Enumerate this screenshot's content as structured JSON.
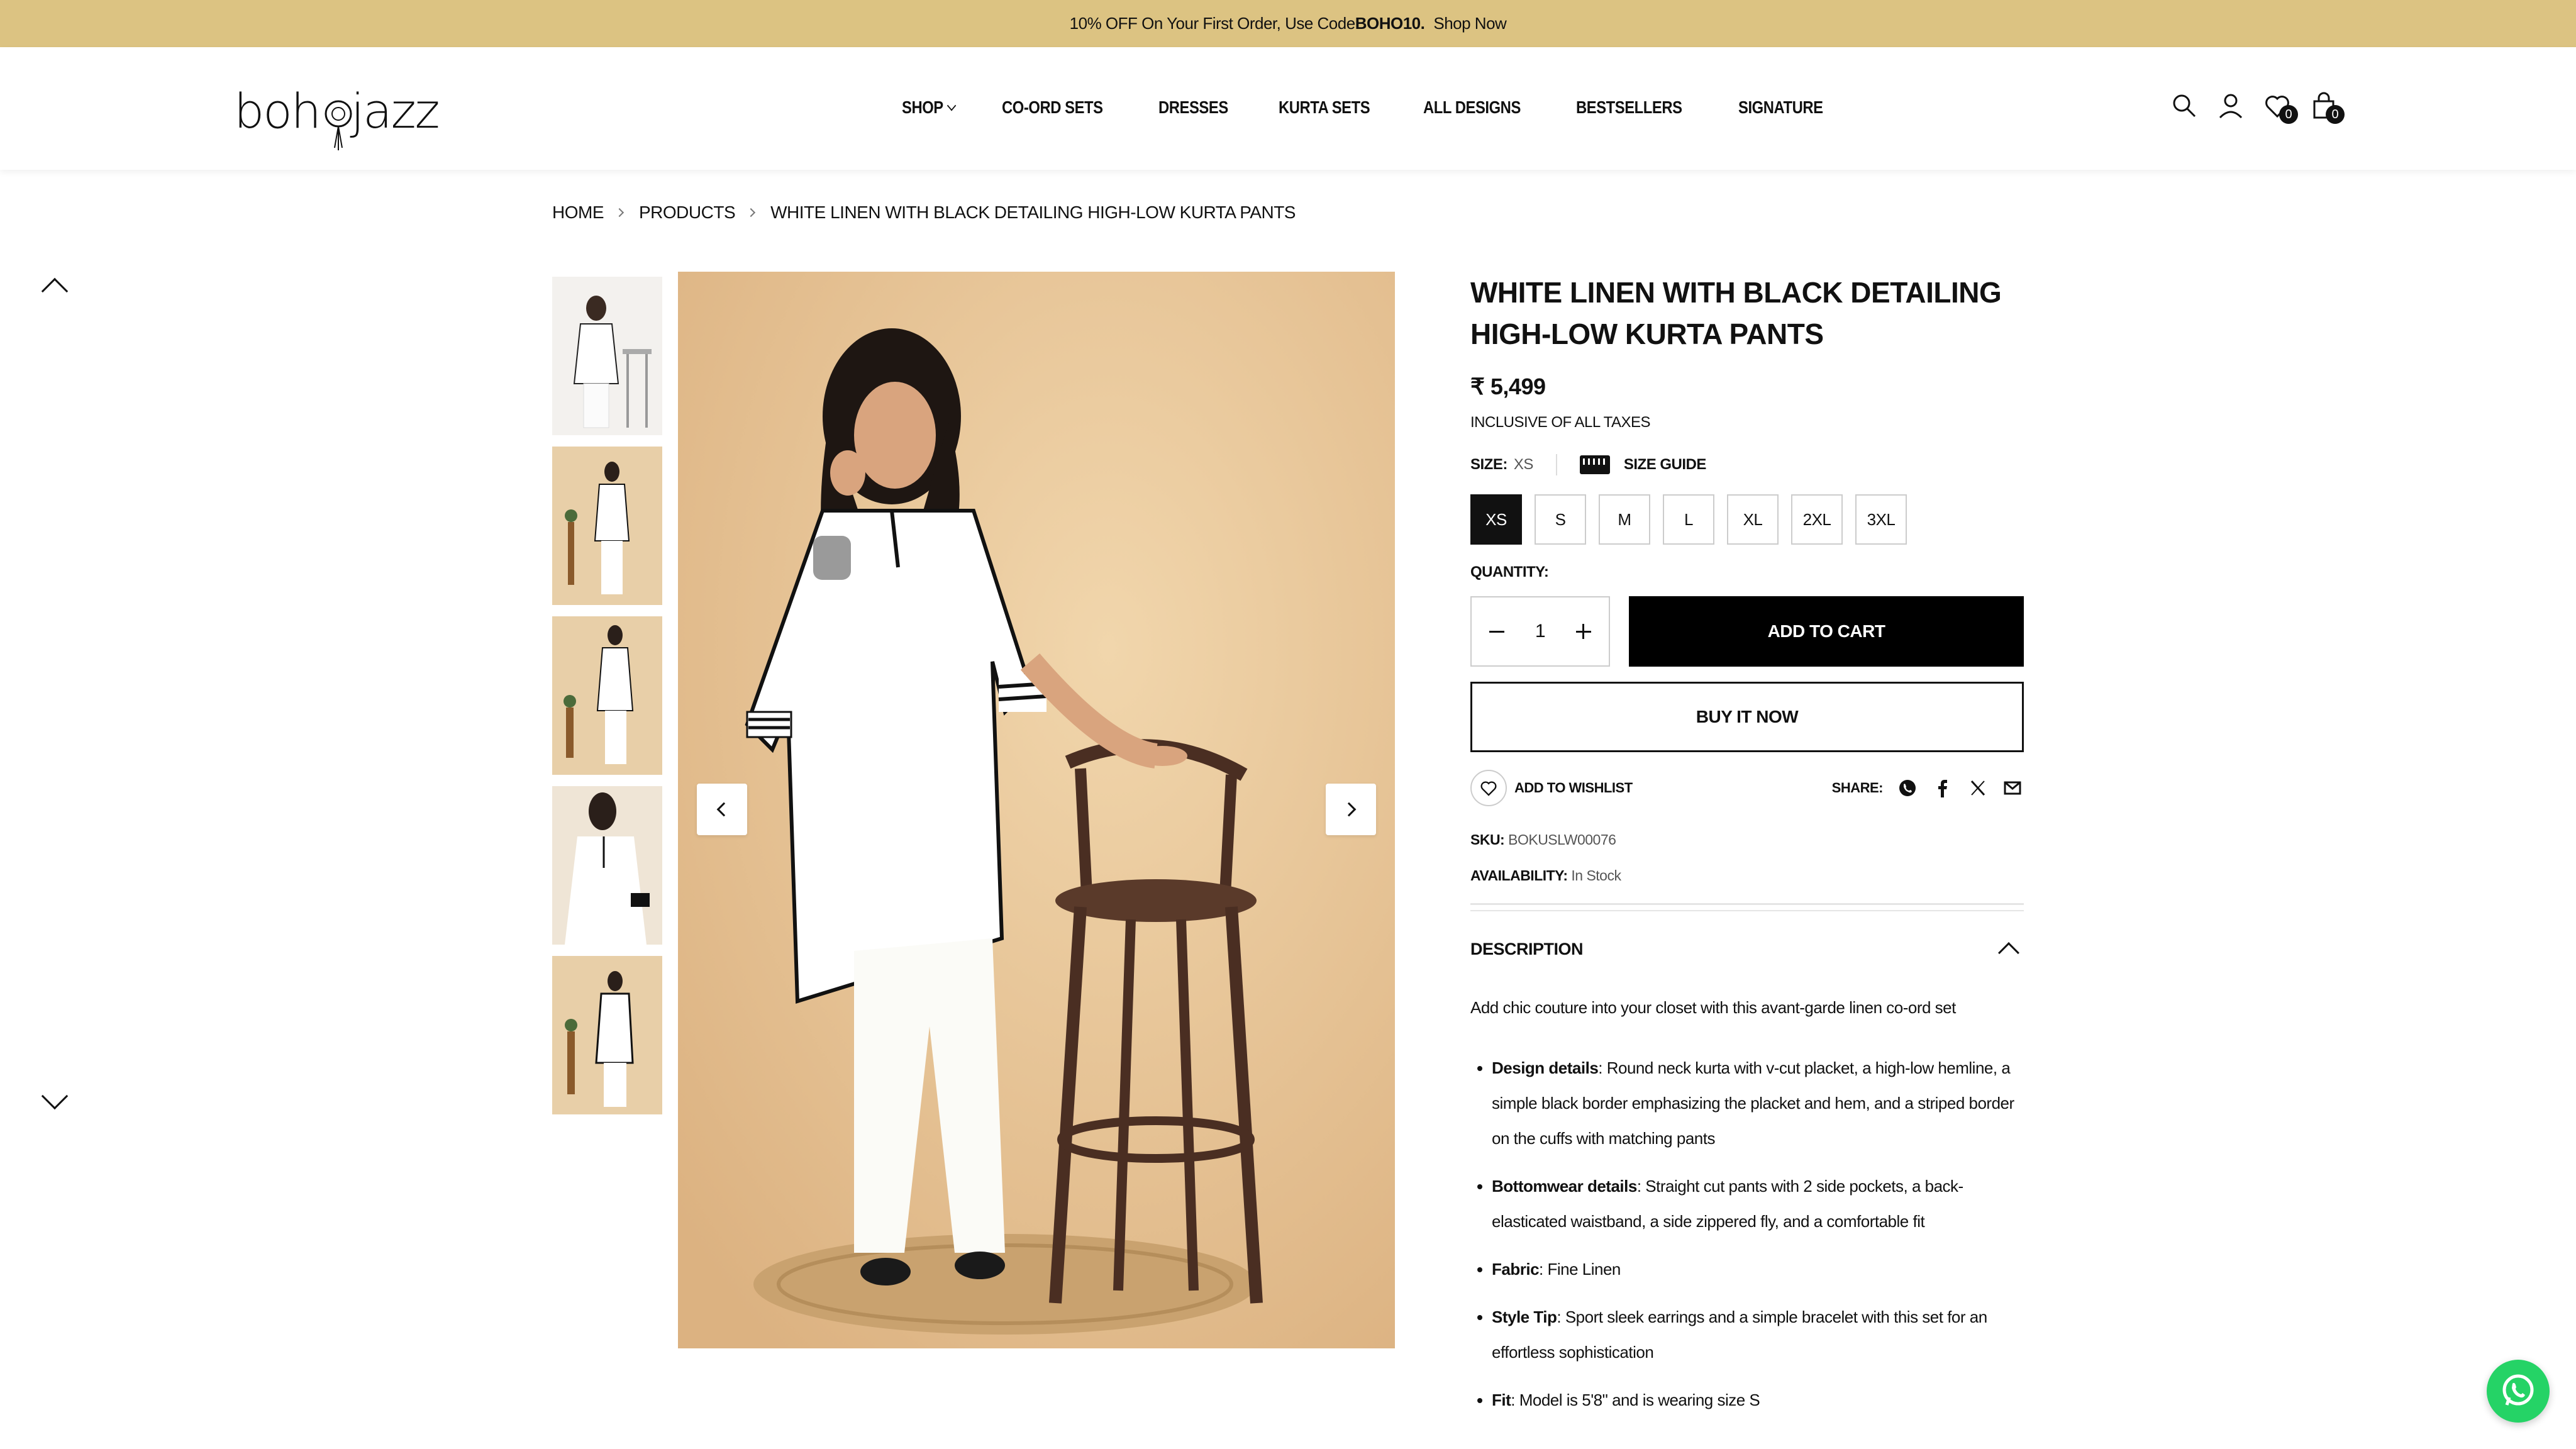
{
  "announcement": {
    "text_before": "10% OFF On Your First Order, Use Code ",
    "code": "BOHO10.",
    "shop_now": "Shop Now"
  },
  "header": {
    "logo_text": "bohojazz",
    "nav": [
      "SHOP",
      "CO-ORD SETS",
      "DRESSES",
      "KURTA SETS",
      "ALL DESIGNS",
      "BESTSELLERS",
      "SIGNATURE"
    ],
    "wishlist_count": "0",
    "cart_count": "0",
    "icons": [
      "search-icon",
      "user-icon",
      "heart-icon",
      "bag-icon"
    ]
  },
  "breadcrumb": [
    "HOME",
    "PRODUCTS",
    "WHITE LINEN WITH BLACK DETAILING HIGH-LOW KURTA PANTS"
  ],
  "product": {
    "title": "WHITE LINEN WITH BLACK DETAILING HIGH-LOW KURTA PANTS",
    "price": "₹ 5,499",
    "tax_note": "INCLUSIVE OF ALL TAXES",
    "size_label": "SIZE:",
    "size_selected": "XS",
    "size_guide": "SIZE GUIDE",
    "sizes": [
      "XS",
      "S",
      "M",
      "L",
      "XL",
      "2XL",
      "3XL"
    ],
    "quantity_label": "QUANTITY:",
    "quantity": "1",
    "add_to_cart": "ADD TO CART",
    "buy_now": "BUY IT NOW",
    "wishlist": "ADD TO WISHLIST",
    "share_label": "SHARE:",
    "sku_label": "SKU:",
    "sku": "BOKUSLW00076",
    "availability_label": "AVAILABILITY:",
    "availability": "In Stock"
  },
  "description": {
    "heading": "DESCRIPTION",
    "intro": "Add chic couture into your closet with this avant-garde linen co-ord set",
    "items": [
      {
        "k": "Design details",
        "v": ": Round neck kurta with v-cut placket, a high-low hemline, a simple black border emphasizing the placket and hem, and a striped border on the cuffs with matching pants"
      },
      {
        "k": "Bottomwear details",
        "v": ": Straight cut pants with 2 side pockets, a back-elasticated waistband, a side zippered fly, and a comfortable fit"
      },
      {
        "k": "Fabric",
        "v": ": Fine Linen"
      },
      {
        "k": "Style Tip",
        "v": ": Sport sleek earrings and a simple bracelet with this set for an effortless sophistication"
      },
      {
        "k": "Fit",
        "v": ": Model is 5'8\" and is wearing size S"
      }
    ]
  },
  "colors": {
    "announcement_bg": "#dcc382",
    "image_bg": "#e9c79c",
    "whatsapp": "#25d366",
    "primary": "#000000"
  }
}
